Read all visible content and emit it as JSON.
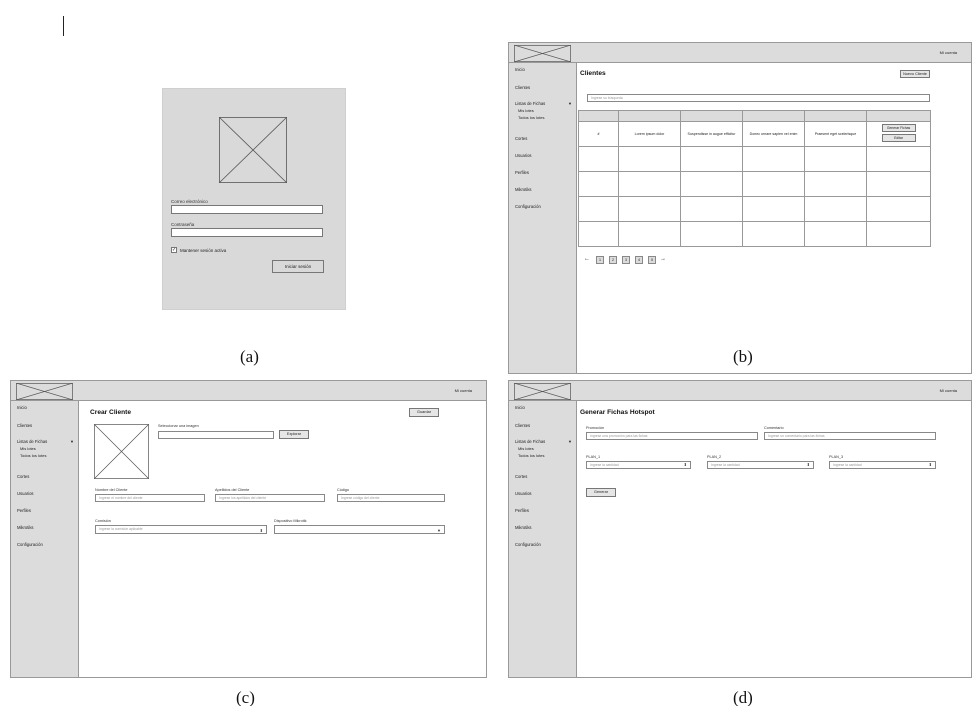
{
  "captions": [
    "(a)",
    "(b)",
    "(c)",
    "(d)"
  ],
  "login": {
    "email_label": "Correo electrónico",
    "password_label": "Contraseña",
    "remember_label": "Mantener sesión activa",
    "remember_checked": true,
    "login_button": "Iniciar sesión"
  },
  "common": {
    "account_label": "Mi cuenta",
    "sidebar": {
      "items": [
        "Inicio",
        "Clientes",
        "Listas de Fichas",
        "Cortes",
        "Usuarios",
        "Perfiles",
        "Mikrotiks",
        "Configuración"
      ],
      "subitems": [
        "Mis lotes",
        "Todos los lotes"
      ],
      "expand_icon": "triangle-down-icon"
    }
  },
  "clients": {
    "title": "Clientes",
    "new_button": "Nuevo Cliente",
    "search_placeholder": "Ingrese su búsqueda",
    "row": {
      "id": "#",
      "c1": "Lorem ipsum dolor",
      "c2": "Suspendisse in augue efficitur",
      "c3": "Donec ornare sapien vel enim",
      "c4": "Praesent eget scelerisque"
    },
    "actions": {
      "generate": "Generar Fichas",
      "edit": "Editar"
    },
    "pagination": {
      "prev": "←",
      "pages": [
        "1",
        "2",
        "3",
        "4",
        "5"
      ],
      "next": "→"
    }
  },
  "create_client": {
    "title": "Crear Cliente",
    "save_button": "Guardar",
    "image_label": "Seleccionar una imagen",
    "browse_button": "Explorar",
    "name_label": "Nombre del Cliente",
    "name_placeholder": "Ingrese el nombre del cliente",
    "surname_label": "Apellidos del Cliente",
    "surname_placeholder": "Ingrese los apellidos del cliente",
    "code_label": "Código",
    "code_placeholder": "Ingrese código del cliente",
    "commission_label": "Comisión",
    "commission_placeholder": "Ingrese la comisión aplicable",
    "device_label": "Dispositivo Mikrotik"
  },
  "generate": {
    "title": "Generar Fichas Hotspot",
    "promo_label": "Promoción",
    "promo_placeholder": "Ingrese una promoción para las fichas",
    "comment_label": "Comentario",
    "comment_placeholder": "Ingrese un comentario para las fichas",
    "plans": [
      {
        "label": "PLAN_1",
        "placeholder": "Ingrese la cantidad"
      },
      {
        "label": "PLAN_2",
        "placeholder": "Ingrese la cantidad"
      },
      {
        "label": "PLAN_3",
        "placeholder": "Ingrese la cantidad"
      }
    ],
    "generate_button": "Generar"
  }
}
